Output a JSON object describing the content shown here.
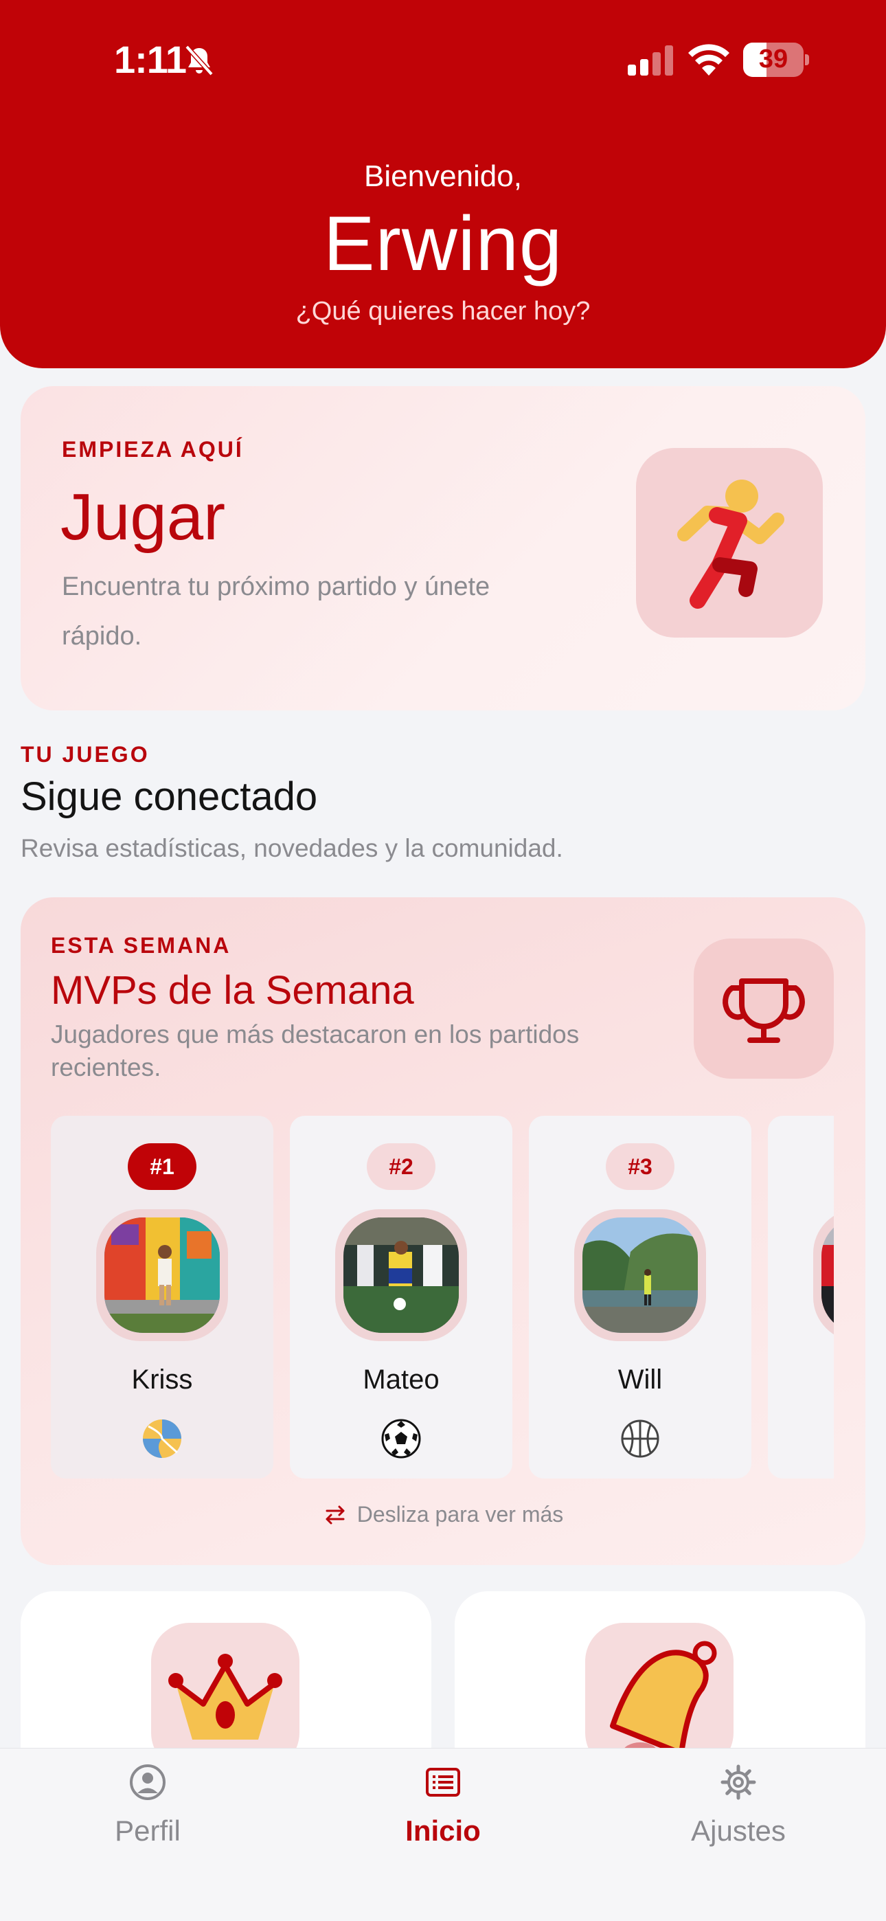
{
  "status_bar": {
    "time": "1:11",
    "battery_level": "39",
    "battery_fraction": 0.39
  },
  "header": {
    "greeting": "Bienvenido,",
    "username": "Erwing",
    "tagline": "¿Qué quieres hacer hoy?"
  },
  "play_card": {
    "eyebrow": "EMPIEZA AQUÍ",
    "title": "Jugar",
    "description": "Encuentra tu próximo partido y únete rápido.",
    "icon": "running-person-icon"
  },
  "section": {
    "eyebrow": "TU JUEGO",
    "title": "Sigue conectado",
    "description": "Revisa estadísticas, novedades y la comunidad."
  },
  "mvp": {
    "eyebrow": "ESTA SEMANA",
    "title": "MVPs de la Semana",
    "description": "Jugadores que más destacaron en los partidos recientes.",
    "icon": "trophy-icon",
    "players": [
      {
        "rank": "#1",
        "name": "Kriss",
        "sport_icon": "volleyball-icon"
      },
      {
        "rank": "#2",
        "name": "Mateo",
        "sport_icon": "soccer-ball-icon"
      },
      {
        "rank": "#3",
        "name": "Will",
        "sport_icon": "basketball-icon"
      }
    ],
    "swipe_hint": "Desliza para ver más"
  },
  "feature_cards": [
    {
      "icon": "crown-icon"
    },
    {
      "icon": "bell-icon"
    }
  ],
  "bottom_nav": {
    "items": [
      {
        "label": "Perfil",
        "icon": "profile-icon"
      },
      {
        "label": "Inicio",
        "icon": "home-list-icon"
      },
      {
        "label": "Ajustes",
        "icon": "gear-icon"
      }
    ],
    "active": "Inicio"
  },
  "colors": {
    "brand_red": "#c00307",
    "accent_yellow": "#f5c14f",
    "muted_text": "#8a8a8f"
  }
}
